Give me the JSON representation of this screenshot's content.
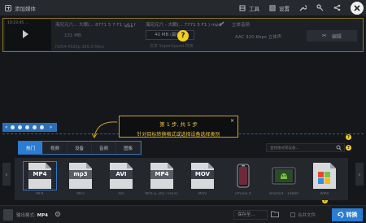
{
  "topbar": {
    "add_media_label": "添加媒体",
    "tools_label": "工具",
    "settings_label": "设置"
  },
  "file": {
    "thumb_timestamp": "10:23:45 ...",
    "source_name": "海兄元六... 大眼(...  8771 5 7 F1 ) 4 f f",
    "source_size": "131 MB",
    "source_format": "H264 4320p 365.0 Mb/s",
    "arrow": "▸▸▸",
    "output_name": "海兄元六 - 大眼(...  7771 5 F1 ) mp4",
    "output_size": "40 MB (最佳)",
    "output_info": "文本 SuperSpeed 转换",
    "audio_track": "立体音频",
    "audio_codec": "AAC 320 Kbps 立体声",
    "edit_label": "编辑"
  },
  "help_mark": "?",
  "steps": {
    "arrow_left": "«",
    "arrow_right": "»",
    "dots": 5
  },
  "tooltip": {
    "title": "第 1 步, 共 5 步",
    "body": "针对目标转换格式或选择设备选择类别",
    "close": "×"
  },
  "tabs": [
    {
      "label": "热门",
      "active": true
    },
    {
      "label": "视频",
      "active": false
    },
    {
      "label": "设备",
      "active": false
    },
    {
      "label": "音频",
      "active": false
    },
    {
      "label": "图像",
      "active": false
    }
  ],
  "search": {
    "placeholder": "查找格式或设备..."
  },
  "formats": [
    {
      "code": "MP4",
      "caption": "MP4",
      "selected": true
    },
    {
      "code": "mp3",
      "caption": "MP3",
      "selected": false
    },
    {
      "code": "AVI",
      "caption": "AVI",
      "selected": false
    },
    {
      "code": "MP4",
      "caption": "MP4 & 265 / HEVC",
      "selected": false
    },
    {
      "code": "MOV",
      "caption": "MOV",
      "selected": false
    },
    {
      "code": "",
      "caption": "iPhone X",
      "selected": false
    },
    {
      "code": "",
      "caption": "Android - 1080P",
      "selected": false
    },
    {
      "code": "",
      "caption": "WMV",
      "selected": false
    }
  ],
  "side_arrows": {
    "left": "‹",
    "right": "›"
  },
  "bottombar": {
    "output_prefix": "输出格式:",
    "output_format": "MP4",
    "save_to_label": "保存至...",
    "merge_label": "合并文件",
    "convert_label": "转换"
  }
}
